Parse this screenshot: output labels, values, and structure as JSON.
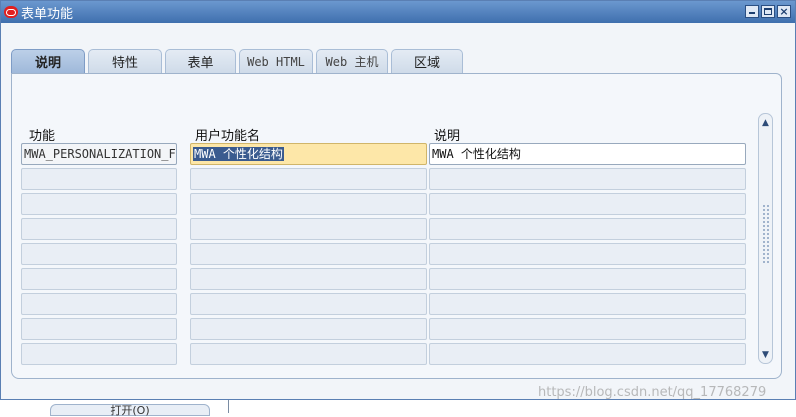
{
  "window": {
    "title": "表单功能",
    "controls": [
      "minimize-icon",
      "maximize-icon",
      "close-icon"
    ]
  },
  "tabs": [
    {
      "label": "说明",
      "active": true
    },
    {
      "label": "特性",
      "active": false
    },
    {
      "label": "表单",
      "active": false
    },
    {
      "label": "Web HTML",
      "active": false
    },
    {
      "label": "Web 主机",
      "active": false
    },
    {
      "label": "区域",
      "active": false
    }
  ],
  "grid": {
    "headers": {
      "function": "功能",
      "user_function_name": "用户功能名",
      "description": "说明"
    },
    "rows": [
      {
        "function": "MWA_PERSONALIZATION_F",
        "user_function_name": "MWA 个性化结构",
        "description": "MWA 个性化结构"
      },
      {
        "function": "",
        "user_function_name": "",
        "description": ""
      },
      {
        "function": "",
        "user_function_name": "",
        "description": ""
      },
      {
        "function": "",
        "user_function_name": "",
        "description": ""
      },
      {
        "function": "",
        "user_function_name": "",
        "description": ""
      },
      {
        "function": "",
        "user_function_name": "",
        "description": ""
      },
      {
        "function": "",
        "user_function_name": "",
        "description": ""
      },
      {
        "function": "",
        "user_function_name": "",
        "description": ""
      },
      {
        "function": "",
        "user_function_name": "",
        "description": ""
      }
    ]
  },
  "scrollbar": {
    "up_icon": "scroll-up-icon",
    "down_icon": "scroll-down-icon"
  },
  "bottom_tab": {
    "label": "打开(O)"
  },
  "watermark": "https://blog.csdn.net/qq_17768279",
  "colors": {
    "titlebar": "#4f7fbf",
    "focus_field": "#fde7a8",
    "selection": "#3a5b8f",
    "active_tab": "#a9c0de"
  }
}
